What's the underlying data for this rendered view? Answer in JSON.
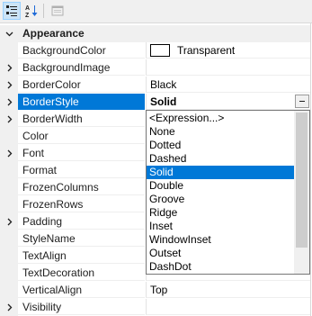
{
  "toolbar": {
    "buttons": [
      {
        "name": "categorized-icon",
        "active": true
      },
      {
        "name": "alphabetical-icon",
        "active": false
      },
      {
        "name": "property-pages-icon",
        "active": false
      }
    ]
  },
  "grid": {
    "category": "Appearance",
    "properties": [
      {
        "name": "BackgroundColor",
        "value": "Transparent",
        "expandable": false,
        "swatch": true
      },
      {
        "name": "BackgroundImage",
        "value": "",
        "expandable": true
      },
      {
        "name": "BorderColor",
        "value": "Black",
        "expandable": true
      },
      {
        "name": "BorderStyle",
        "value": "Solid",
        "expandable": true,
        "selected": true
      },
      {
        "name": "BorderWidth",
        "value": "",
        "expandable": true
      },
      {
        "name": "Color",
        "value": "",
        "expandable": false
      },
      {
        "name": "Font",
        "value": "",
        "expandable": true
      },
      {
        "name": "Format",
        "value": "",
        "expandable": false
      },
      {
        "name": "FrozenColumns",
        "value": "",
        "expandable": false
      },
      {
        "name": "FrozenRows",
        "value": "",
        "expandable": false
      },
      {
        "name": "Padding",
        "value": "",
        "expandable": true
      },
      {
        "name": "StyleName",
        "value": "",
        "expandable": false
      },
      {
        "name": "TextAlign",
        "value": "",
        "expandable": false
      },
      {
        "name": "TextDecoration",
        "value": "",
        "expandable": false
      },
      {
        "name": "VerticalAlign",
        "value": "Top",
        "expandable": false
      },
      {
        "name": "Visibility",
        "value": "",
        "expandable": true
      }
    ]
  },
  "dropdown": {
    "options": [
      "<Expression...>",
      "None",
      "Dotted",
      "Dashed",
      "Solid",
      "Double",
      "Groove",
      "Ridge",
      "Inset",
      "WindowInset",
      "Outset",
      "DashDot"
    ],
    "selected": "Solid"
  },
  "colors": {
    "selection": "#0078d7",
    "category_bg": "#f0f0f0"
  }
}
